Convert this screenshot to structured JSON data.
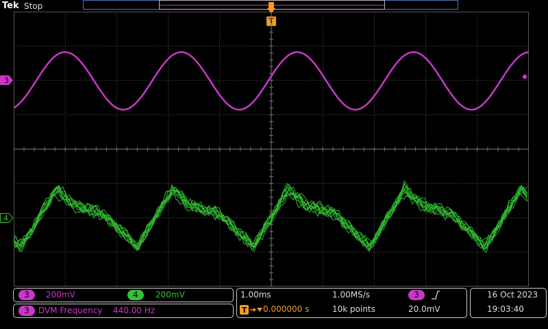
{
  "header": {
    "brand": "Tek",
    "status": "Stop",
    "trigger_label": "T"
  },
  "channels": [
    {
      "label": "3",
      "scale": "200mV",
      "color": "#c838c8"
    },
    {
      "label": "4",
      "scale": "200mV",
      "color": "#34c034"
    }
  ],
  "measurement": {
    "channel": "3",
    "name": "DVM Frequency",
    "value": "440.00 Hz"
  },
  "timebase": {
    "horizontal_scale": "1.00ms",
    "sample_rate": "1.00MS/s",
    "trigger_delay": "0.000000 s",
    "record_length": "10k points",
    "trigger_channel": "3",
    "trigger_slope_icon": "rising-edge-icon",
    "trigger_level": "20.0mV"
  },
  "datetime": {
    "date": "16 Oct 2023",
    "time": "19:03:40"
  },
  "colors": {
    "trigger": "#f59a1c",
    "grid": "#555555",
    "ch3": "#c838c8",
    "ch4": "#34c034"
  }
}
